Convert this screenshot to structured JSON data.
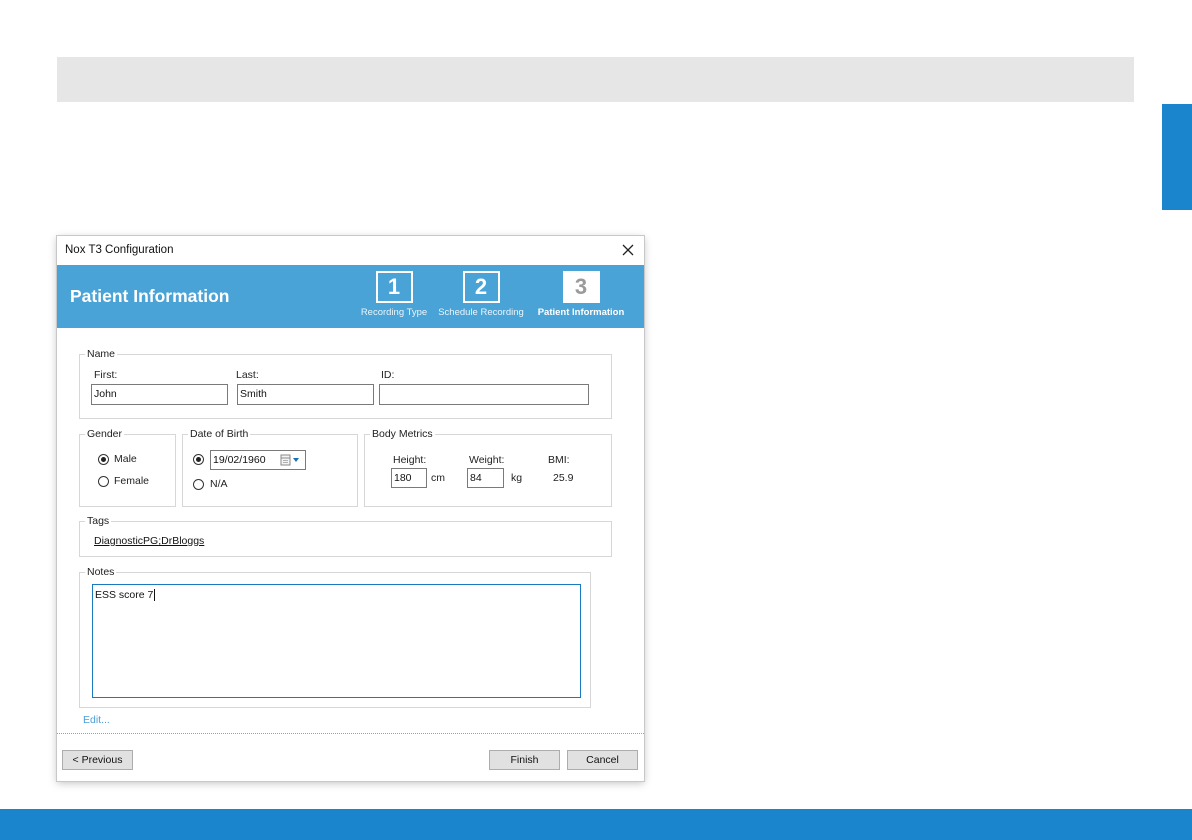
{
  "dialog": {
    "title": "Nox T3 Configuration",
    "header_title": "Patient Information",
    "steps": [
      {
        "number": "1",
        "label": "Recording Type"
      },
      {
        "number": "2",
        "label": "Schedule Recording"
      },
      {
        "number": "3",
        "label": "Patient Information",
        "active": true
      }
    ]
  },
  "name_group": {
    "legend": "Name",
    "first_label": "First:",
    "first_value": "John",
    "last_label": "Last:",
    "last_value": "Smith",
    "id_label": "ID:",
    "id_value": ""
  },
  "gender_group": {
    "legend": "Gender",
    "options": [
      {
        "label": "Male",
        "selected": true
      },
      {
        "label": "Female",
        "selected": false
      }
    ]
  },
  "dob_group": {
    "legend": "Date of Birth",
    "date_value": "19/02/1960",
    "na_label": "N/A",
    "date_selected": true
  },
  "metrics_group": {
    "legend": "Body Metrics",
    "height_label": "Height:",
    "height_value": "180",
    "height_unit": "cm",
    "weight_label": "Weight:",
    "weight_value": "84",
    "weight_unit": "kg",
    "bmi_label": "BMI:",
    "bmi_value": "25.9"
  },
  "tags_group": {
    "legend": "Tags",
    "value": "DiagnosticPG;DrBloggs"
  },
  "notes_group": {
    "legend": "Notes",
    "value": "ESS score 7"
  },
  "footer": {
    "edit_label": "Edit...",
    "previous_label": "< Previous",
    "finish_label": "Finish",
    "cancel_label": "Cancel"
  },
  "colors": {
    "header_blue": "#4aa3d6",
    "brand_blue": "#1a84cc",
    "band_gray": "#e6e6e6"
  },
  "icons": [
    "close-icon",
    "calendar-icon",
    "chevron-down-icon"
  ]
}
